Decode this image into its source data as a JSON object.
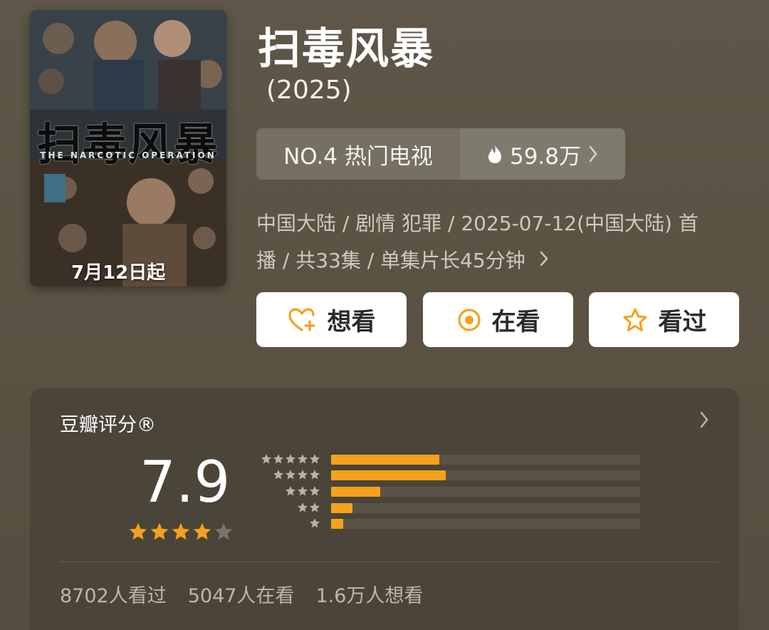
{
  "poster": {
    "title": "扫毒风暴",
    "subtitle": "THE NARCOTIC OPERATION",
    "date_badge": "7月12日起"
  },
  "show": {
    "title": "扫毒风暴",
    "year": "(2025)"
  },
  "ranking": {
    "label": "NO.4 热门电视",
    "heat": "59.8万",
    "heat_icon": "flame-icon"
  },
  "meta": {
    "line1": "中国大陆 / 剧情 犯罪 / 2025-07-12(中国大陆) 首",
    "line2": "播 / 共33集 / 单集片长45分钟"
  },
  "actions": {
    "want": "想看",
    "watching": "在看",
    "watched": "看过"
  },
  "rating": {
    "title": "豆瓣评分®",
    "score": "7.9",
    "score_stars": 4,
    "distribution_percent": [
      35,
      37,
      16,
      7,
      4
    ],
    "stats": {
      "watched": "8702人看过",
      "watching": "5047人在看",
      "want": "1.6万人想看"
    }
  },
  "colors": {
    "accent": "#f5a11d",
    "background": "#5b5446",
    "card": "#4b4438"
  }
}
